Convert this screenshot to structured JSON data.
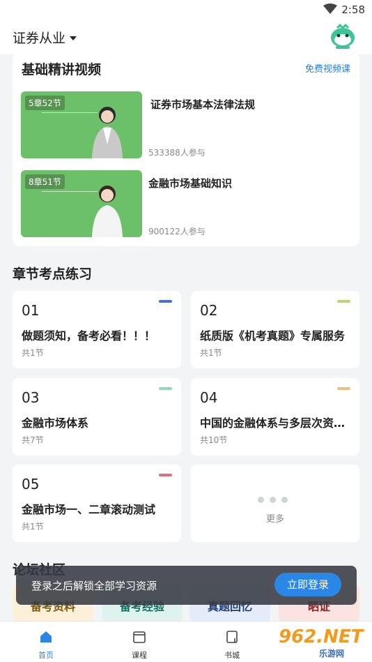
{
  "status": {
    "time": "2:58"
  },
  "appbar": {
    "exam": "证券从业"
  },
  "video_section": {
    "title": "基础精讲视频",
    "link": "免费视频课",
    "courses": [
      {
        "badge": "5章52节",
        "title": "证券市场基本法律法规",
        "participants": "533388人参与"
      },
      {
        "badge": "8章51节",
        "title": "金融市场基础知识",
        "participants": "900122人参与"
      }
    ]
  },
  "chapter_section": {
    "title": "章节考点练习",
    "items": [
      {
        "num": "01",
        "name": "做题须知，备考必看！！！",
        "count": "共1节",
        "color": "#4a6fd8"
      },
      {
        "num": "02",
        "name": "纸质版《机考真题》专属服务",
        "count": "共1节",
        "color": "#b5d87a"
      },
      {
        "num": "03",
        "name": "金融市场体系",
        "count": "共7节",
        "color": "#8fd9b8"
      },
      {
        "num": "04",
        "name": "中国的金融体系与多层次资本市场",
        "count": "共10节",
        "color": "#e7c084"
      },
      {
        "num": "05",
        "name": "金融市场一、二章滚动测试",
        "count": "共1节",
        "color": "#d9757a"
      }
    ],
    "more": "更多"
  },
  "forum": {
    "title": "论坛社区",
    "items": [
      {
        "label": "备考资料",
        "color": "#7a5a10",
        "bg": "#fdf0d8"
      },
      {
        "label": "备考经验",
        "color": "#0e6b5c",
        "bg": "#dff3ee"
      },
      {
        "label": "真题回忆",
        "color": "#1f3d7a",
        "bg": "#e4ecfa"
      },
      {
        "label": "晒证",
        "color": "#8a1f1f",
        "bg": "#fbe3e1"
      }
    ]
  },
  "login_banner": {
    "text": "登录之后解锁全部学习资源",
    "button": "立即登录"
  },
  "tabs": [
    {
      "label": "首页",
      "active": true,
      "icon": "home-icon"
    },
    {
      "label": "课程",
      "active": false,
      "icon": "course-icon"
    },
    {
      "label": "书城",
      "active": false,
      "icon": "book-icon"
    }
  ],
  "watermark": {
    "big": "962.NET",
    "small": "乐游网"
  },
  "colors": {
    "accent": "#2b87e6",
    "thumb_green": "#6cc06a"
  }
}
